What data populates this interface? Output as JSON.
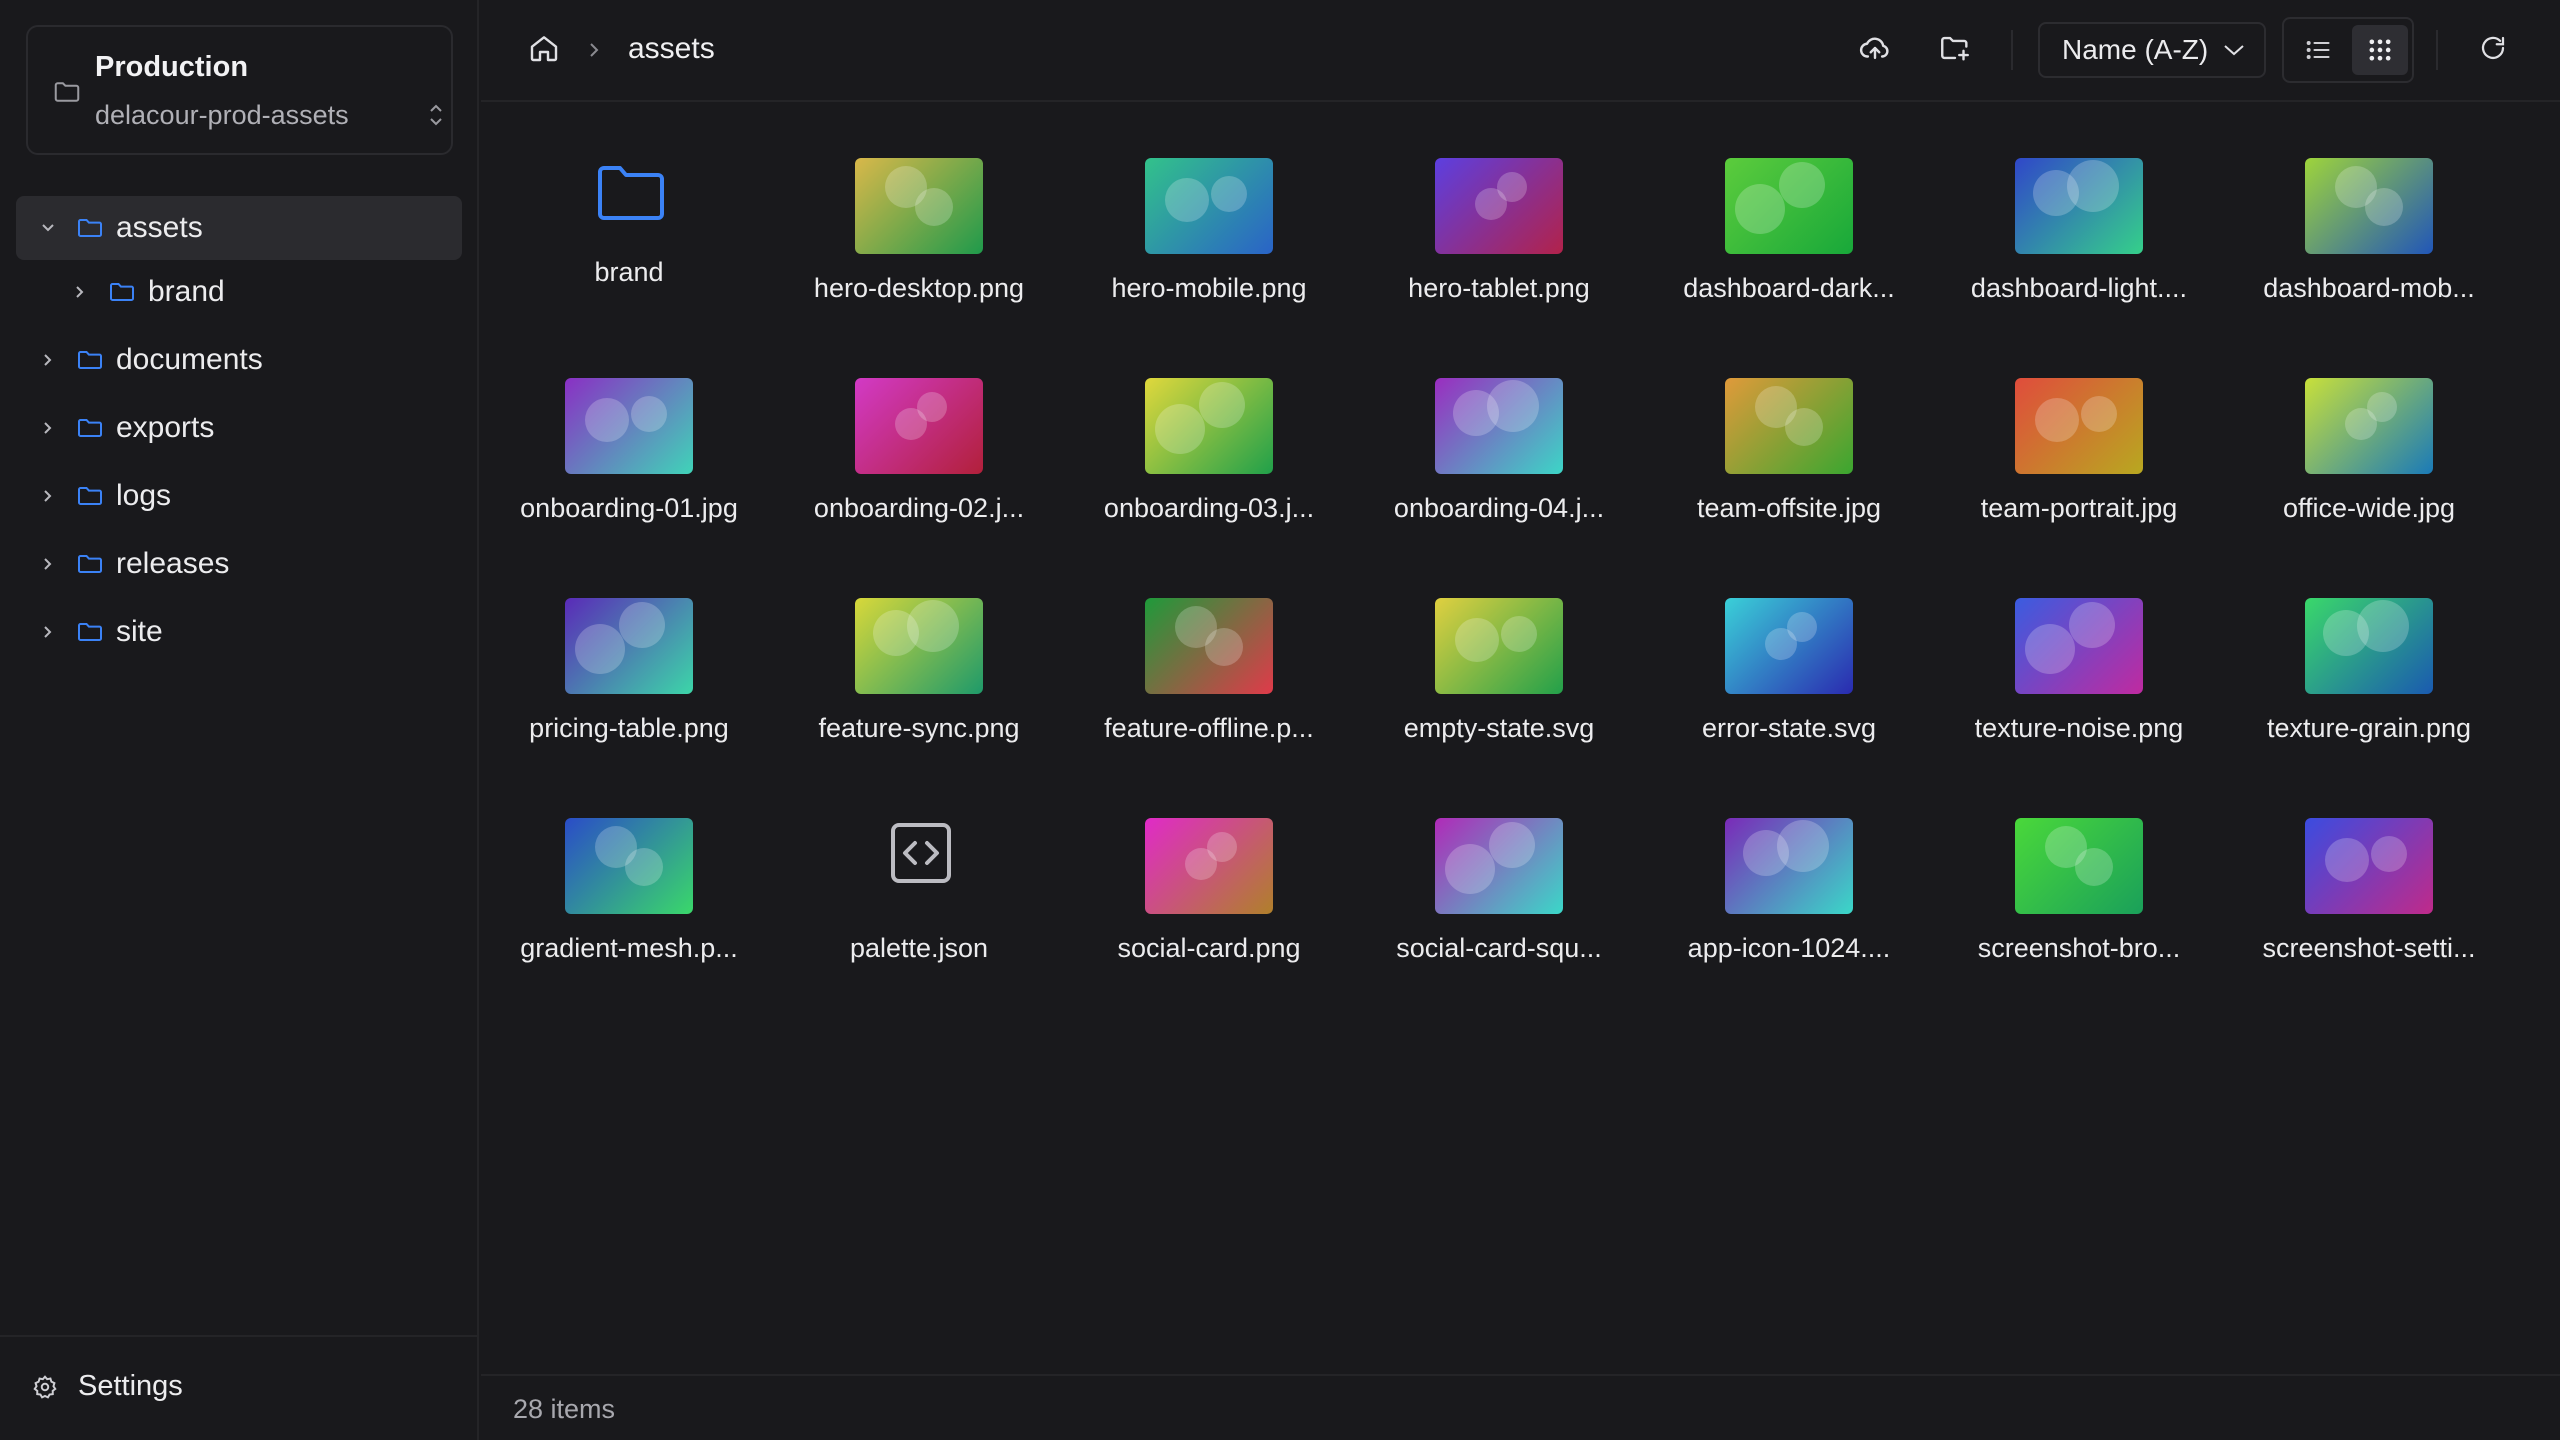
{
  "bucket": {
    "title": "Production",
    "name": "delacour-prod-assets"
  },
  "tree": [
    {
      "label": "assets",
      "expanded": true,
      "active": true
    },
    {
      "label": "brand",
      "expanded": false,
      "child": true
    },
    {
      "label": "documents",
      "expanded": false
    },
    {
      "label": "exports",
      "expanded": false
    },
    {
      "label": "logs",
      "expanded": false
    },
    {
      "label": "releases",
      "expanded": false
    },
    {
      "label": "site",
      "expanded": false
    }
  ],
  "settings_label": "Settings",
  "breadcrumb": {
    "current": "assets"
  },
  "toolbar": {
    "sort_label": "Name (A-Z)",
    "view_mode": "grid"
  },
  "files": [
    {
      "name": "brand",
      "kind": "folder"
    },
    {
      "name": "hero-desktop.png",
      "kind": "image",
      "colors": [
        "#d9b84a",
        "#1f9a4b"
      ]
    },
    {
      "name": "hero-mobile.png",
      "kind": "image",
      "colors": [
        "#32c28a",
        "#2a63c7"
      ]
    },
    {
      "name": "hero-tablet.png",
      "kind": "image",
      "colors": [
        "#5c3fe0",
        "#b2224a"
      ]
    },
    {
      "name": "dashboard-dark...",
      "kind": "image",
      "colors": [
        "#5ccc3c",
        "#18a83a"
      ]
    },
    {
      "name": "dashboard-light....",
      "kind": "image",
      "colors": [
        "#3047c9",
        "#35d08a"
      ]
    },
    {
      "name": "dashboard-mob...",
      "kind": "image",
      "colors": [
        "#9ed43b",
        "#2156b8"
      ]
    },
    {
      "name": "onboarding-01.jpg",
      "kind": "image",
      "colors": [
        "#8a2fc4",
        "#3fd4b8"
      ]
    },
    {
      "name": "onboarding-02.j...",
      "kind": "image",
      "colors": [
        "#d23ac6",
        "#b2203a"
      ]
    },
    {
      "name": "onboarding-03.j...",
      "kind": "image",
      "colors": [
        "#e0d83c",
        "#20a04a"
      ]
    },
    {
      "name": "onboarding-04.j...",
      "kind": "image",
      "colors": [
        "#9a2dc0",
        "#3cd6c6"
      ]
    },
    {
      "name": "team-offsite.jpg",
      "kind": "image",
      "colors": [
        "#e09a3a",
        "#3aa630"
      ]
    },
    {
      "name": "team-portrait.jpg",
      "kind": "image",
      "colors": [
        "#e04c3c",
        "#b8a820"
      ]
    },
    {
      "name": "office-wide.jpg",
      "kind": "image",
      "colors": [
        "#c8e03a",
        "#1a7ab8"
      ]
    },
    {
      "name": "pricing-table.png",
      "kind": "image",
      "colors": [
        "#5a2ab8",
        "#3cd6a8"
      ]
    },
    {
      "name": "feature-sync.png",
      "kind": "image",
      "colors": [
        "#d8d83a",
        "#1e9a6a"
      ]
    },
    {
      "name": "feature-offline.p...",
      "kind": "image",
      "colors": [
        "#1e9a3a",
        "#e03a4a"
      ]
    },
    {
      "name": "empty-state.svg",
      "kind": "image",
      "colors": [
        "#e0d040",
        "#22a04a"
      ]
    },
    {
      "name": "error-state.svg",
      "kind": "image",
      "colors": [
        "#3ad0d8",
        "#2a2ab0"
      ]
    },
    {
      "name": "texture-noise.png",
      "kind": "image",
      "colors": [
        "#3a5ce0",
        "#c02aa0"
      ]
    },
    {
      "name": "texture-grain.png",
      "kind": "image",
      "colors": [
        "#3ad86a",
        "#1a5ab0"
      ]
    },
    {
      "name": "gradient-mesh.p...",
      "kind": "image",
      "colors": [
        "#2a4cc8",
        "#3ad86a"
      ]
    },
    {
      "name": "palette.json",
      "kind": "code"
    },
    {
      "name": "social-card.png",
      "kind": "image",
      "colors": [
        "#e02ac8",
        "#b0802a"
      ]
    },
    {
      "name": "social-card-squ...",
      "kind": "image",
      "colors": [
        "#b02ab8",
        "#3ad8c8"
      ]
    },
    {
      "name": "app-icon-1024....",
      "kind": "image",
      "colors": [
        "#7a2ab8",
        "#3ad8c8"
      ]
    },
    {
      "name": "screenshot-bro...",
      "kind": "image",
      "colors": [
        "#4ad83a",
        "#1aa05a"
      ]
    },
    {
      "name": "screenshot-setti...",
      "kind": "image",
      "colors": [
        "#3a4ce0",
        "#c02a8a"
      ]
    }
  ],
  "status": {
    "count": "28 items"
  },
  "colors": {
    "accent": "#3b82f6",
    "bg": "#19191c",
    "border": "#2a2a2e"
  }
}
